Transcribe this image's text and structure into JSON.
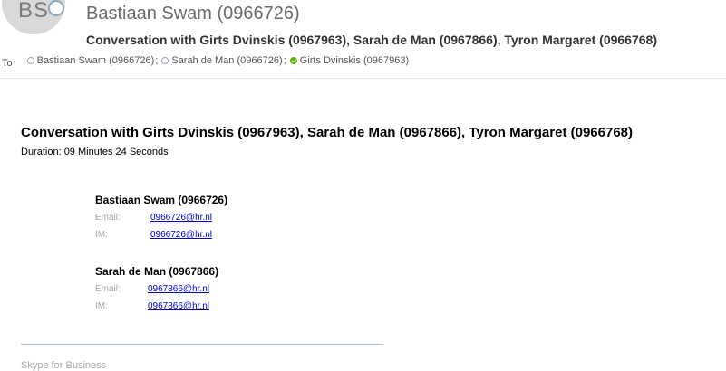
{
  "header": {
    "avatar_initials": "BS",
    "sender": "Bastiaan Swam (0966726)",
    "subject": "Conversation with Girts Dvinskis (0967963), Sarah de Man (0967866), Tyron Margaret (0966768)",
    "to_label": "To",
    "recipients": [
      {
        "name": "Bastiaan Swam (0966726)",
        "presence": "offline"
      },
      {
        "name": "Sarah de Man (0966726)",
        "presence": "offline"
      },
      {
        "name": "Girts Dvinskis (0967963)",
        "presence": "available"
      }
    ],
    "separator": ";"
  },
  "body": {
    "title": "Conversation with Girts Dvinskis (0967963), Sarah de Man (0967866), Tyron Margaret (0966768)",
    "duration": "Duration: 09 Minutes 24 Seconds",
    "participants": [
      {
        "name": "Bastiaan Swam (0966726)",
        "email_label": "Email:",
        "email": "0966726@hr.nl",
        "im_label": "IM:",
        "im": "0966726@hr.nl"
      },
      {
        "name": "Sarah de Man (0967866)",
        "email_label": "Email:",
        "email": "0967866@hr.nl",
        "im_label": "IM:",
        "im": "0967866@hr.nl"
      }
    ],
    "footer": "Skype for Business"
  },
  "colors": {
    "link": "#0000cc",
    "available": "#5bb300",
    "presence_ring": "#8aa8c6"
  }
}
